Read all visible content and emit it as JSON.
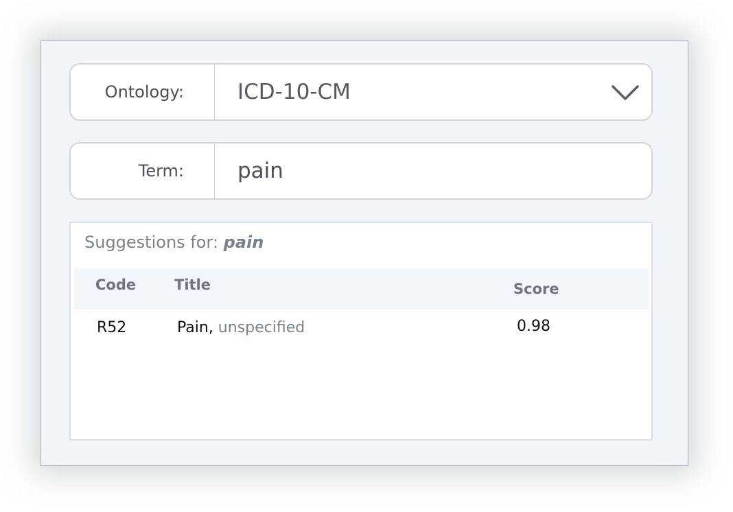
{
  "ontology": {
    "label": "Ontology:",
    "selected": "ICD-10-CM",
    "dropdown_icon": "chevron-down-icon"
  },
  "term": {
    "label": "Term:",
    "value": "pain"
  },
  "suggestions": {
    "heading_prefix": "Suggestions for: ",
    "heading_term": "pain",
    "columns": {
      "code": "Code",
      "title": "Title",
      "score": "Score"
    },
    "rows": [
      {
        "code": "R52",
        "title_main": "Pain,",
        "title_rest": " unspecified",
        "score": "0.98"
      }
    ]
  }
}
